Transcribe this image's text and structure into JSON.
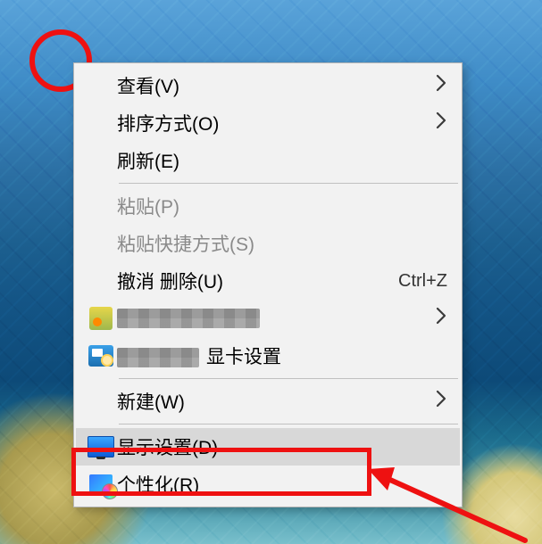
{
  "menu": {
    "view": {
      "label": "查看(V)"
    },
    "sort": {
      "label": "排序方式(O)"
    },
    "refresh": {
      "label": "刷新(E)"
    },
    "paste": {
      "label": "粘贴(P)"
    },
    "pasteShortcut": {
      "label": "粘贴快捷方式(S)"
    },
    "undo": {
      "label": "撤消 删除(U)",
      "shortcut": "Ctrl+Z"
    },
    "vendor1": {
      "label": ""
    },
    "vendor2": {
      "label_suffix": "显卡设置"
    },
    "new": {
      "label": "新建(W)"
    },
    "display": {
      "label": "显示设置(D)"
    },
    "personalize": {
      "label": "个性化(R)"
    }
  }
}
